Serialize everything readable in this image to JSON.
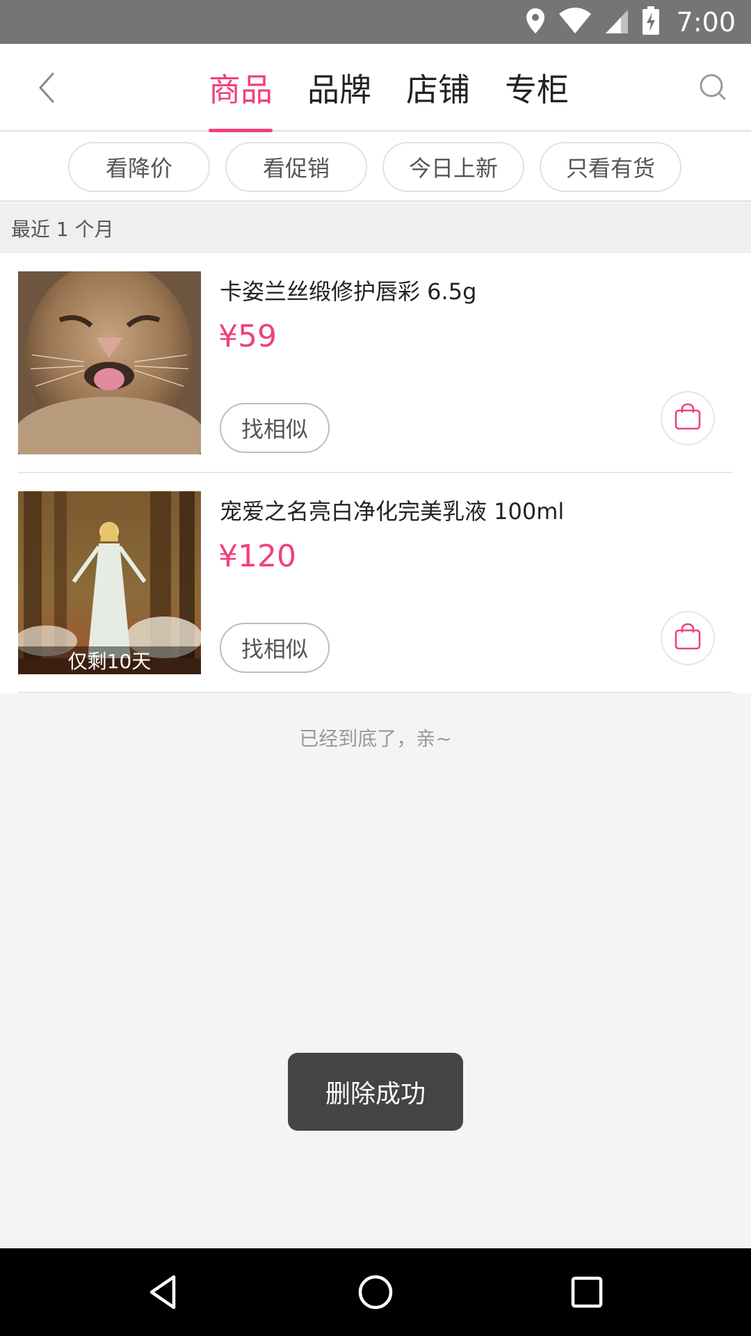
{
  "status_bar": {
    "time": "7:00",
    "icons": [
      "location-icon",
      "wifi-icon",
      "signal-icon",
      "battery-charging-icon"
    ]
  },
  "header": {
    "tabs": [
      {
        "label": "商品",
        "active": true
      },
      {
        "label": "品牌",
        "active": false
      },
      {
        "label": "店铺",
        "active": false
      },
      {
        "label": "专柜",
        "active": false
      }
    ],
    "back_icon": "back-chevron-icon",
    "search_icon": "search-icon",
    "accent_color": "#f0417a"
  },
  "filters": [
    "看降价",
    "看促销",
    "今日上新",
    "只看有货"
  ],
  "section": {
    "label": "最近 1 个月"
  },
  "products": [
    {
      "title": "卡姿兰丝缎修护唇彩 6.5g",
      "price": "¥59",
      "similar_label": "找相似",
      "badge": "",
      "cart_icon": "shopping-bag-icon"
    },
    {
      "title": "宠爱之名亮白净化完美乳液 100ml",
      "price": "¥120",
      "similar_label": "找相似",
      "badge": "仅剩10天",
      "cart_icon": "shopping-bag-icon"
    }
  ],
  "end_text": "已经到底了，亲~",
  "toast": "删除成功",
  "nav_bar": {
    "icons": [
      "nav-back-icon",
      "nav-home-icon",
      "nav-recents-icon"
    ]
  }
}
